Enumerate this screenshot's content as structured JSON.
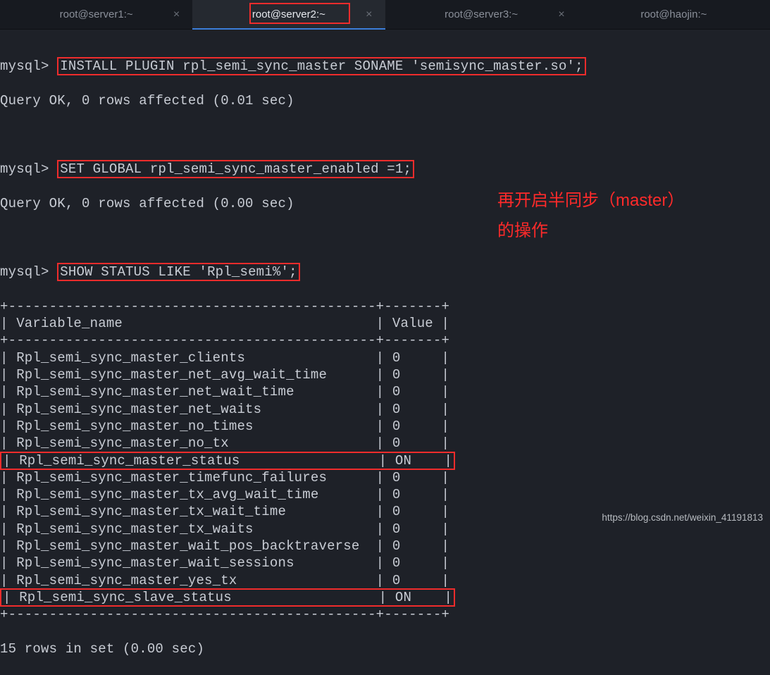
{
  "tabs": {
    "t0": {
      "label": "root@server1:~"
    },
    "t1": {
      "label": "root@server2:~"
    },
    "t2": {
      "label": "root@server3:~"
    },
    "t3": {
      "label": "root@haojin:~"
    }
  },
  "close_glyph": "×",
  "prompt": "mysql>",
  "cmds": {
    "install": "INSTALL PLUGIN rpl_semi_sync_master SONAME 'semisync_master.so';",
    "set": "SET GLOBAL rpl_semi_sync_master_enabled =1;",
    "show": "SHOW STATUS LIKE 'Rpl_semi%';"
  },
  "results": {
    "ok001": "Query OK, 0 rows affected (0.01 sec)",
    "ok000": "Query OK, 0 rows affected (0.00 sec)"
  },
  "table": {
    "hline": "+---------------------------------------------+-------+",
    "header_name": "Variable_name",
    "header_value": "Value",
    "rows": [
      {
        "name": "Rpl_semi_sync_master_clients",
        "value": "0"
      },
      {
        "name": "Rpl_semi_sync_master_net_avg_wait_time",
        "value": "0"
      },
      {
        "name": "Rpl_semi_sync_master_net_wait_time",
        "value": "0"
      },
      {
        "name": "Rpl_semi_sync_master_net_waits",
        "value": "0"
      },
      {
        "name": "Rpl_semi_sync_master_no_times",
        "value": "0"
      },
      {
        "name": "Rpl_semi_sync_master_no_tx",
        "value": "0"
      },
      {
        "name": "Rpl_semi_sync_master_status",
        "value": "ON"
      },
      {
        "name": "Rpl_semi_sync_master_timefunc_failures",
        "value": "0"
      },
      {
        "name": "Rpl_semi_sync_master_tx_avg_wait_time",
        "value": "0"
      },
      {
        "name": "Rpl_semi_sync_master_tx_wait_time",
        "value": "0"
      },
      {
        "name": "Rpl_semi_sync_master_tx_waits",
        "value": "0"
      },
      {
        "name": "Rpl_semi_sync_master_wait_pos_backtraverse",
        "value": "0"
      },
      {
        "name": "Rpl_semi_sync_master_wait_sessions",
        "value": "0"
      },
      {
        "name": "Rpl_semi_sync_master_yes_tx",
        "value": "0"
      },
      {
        "name": "Rpl_semi_sync_slave_status",
        "value": "ON"
      }
    ],
    "footer": "15 rows in set (0.00 sec)"
  },
  "annotation": {
    "line1": "再开启半同步（master）",
    "line2": "的操作"
  },
  "watermark": "https://blog.csdn.net/weixin_41191813"
}
